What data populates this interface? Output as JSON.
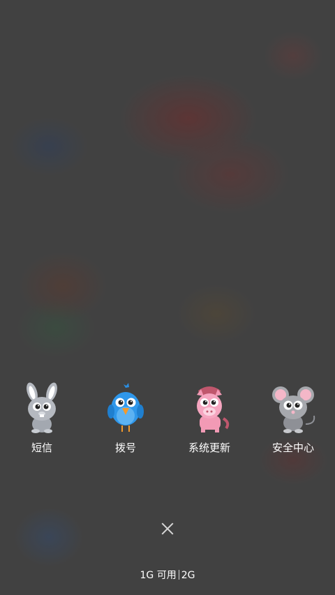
{
  "apps": [
    {
      "label": "短信",
      "icon": "bunny-icon"
    },
    {
      "label": "拨号",
      "icon": "bird-icon"
    },
    {
      "label": "系统更新",
      "icon": "pig-icon"
    },
    {
      "label": "安全中心",
      "icon": "mouse-icon"
    }
  ],
  "memory": {
    "used": "1G 可用",
    "total": "2G"
  },
  "colors": {
    "label_text": "#ffffff",
    "close_icon": "#d6d6d6"
  }
}
